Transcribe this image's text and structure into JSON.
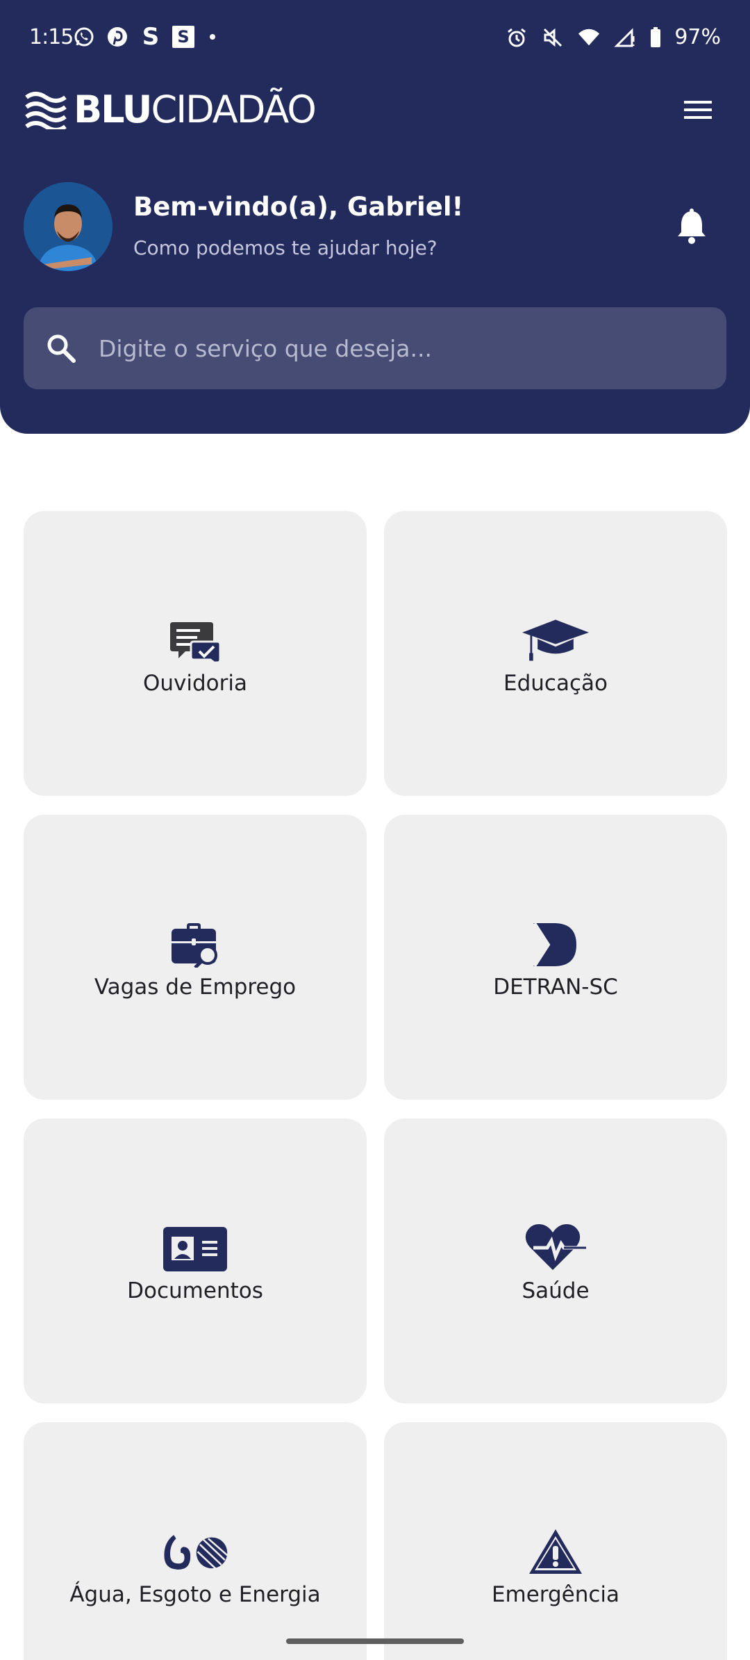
{
  "status_bar": {
    "time": "1:15",
    "s_letter": "S",
    "s_box": "S",
    "battery": "97%"
  },
  "header": {
    "logo_bold": "BLU",
    "logo_thin": "CIDADÃO",
    "welcome_title": "Bem-vindo(a), Gabriel!",
    "welcome_subtitle": "Como podemos te ajudar hoje?"
  },
  "search": {
    "placeholder": "Digite o serviço que deseja..."
  },
  "services": [
    {
      "label": "Ouvidoria",
      "icon": "chat-check-icon"
    },
    {
      "label": "Educação",
      "icon": "graduation-cap-icon"
    },
    {
      "label": "Vagas de Emprego",
      "icon": "briefcase-search-icon"
    },
    {
      "label": "DETRAN-SC",
      "icon": "detran-logo-icon"
    },
    {
      "label": "Documentos",
      "icon": "id-card-icon"
    },
    {
      "label": "Saúde",
      "icon": "heart-pulse-icon"
    },
    {
      "label": "Água, Esgoto e Energia",
      "icon": "water-energy-icon"
    },
    {
      "label": "Emergência",
      "icon": "warning-triangle-icon"
    }
  ],
  "colors": {
    "primary": "#232a5c",
    "search_bg": "#464c74",
    "tile_bg": "#efefef"
  }
}
